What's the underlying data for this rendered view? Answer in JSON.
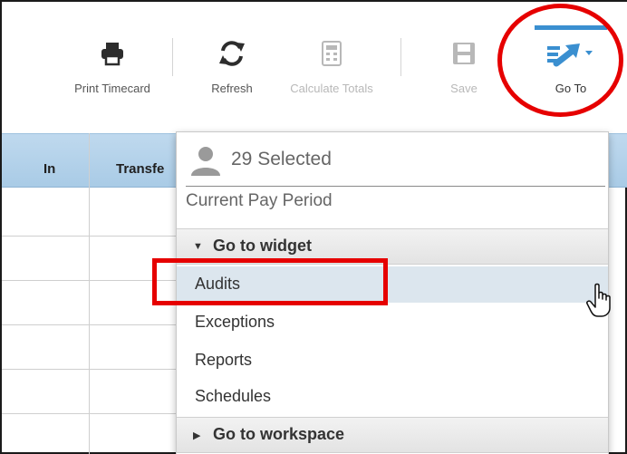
{
  "toolbar": {
    "print_label": "Print Timecard",
    "refresh_label": "Refresh",
    "calculate_label": "Calculate Totals",
    "save_label": "Save",
    "goto_label": "Go To"
  },
  "grid": {
    "columns": [
      "In",
      "Transfe"
    ]
  },
  "menu": {
    "selected_text": "29 Selected",
    "period": "Current Pay Period",
    "widget_section": "Go to widget",
    "widget_items": [
      "Audits",
      "Exceptions",
      "Reports",
      "Schedules"
    ],
    "workspace_section": "Go to workspace",
    "hovered_item": "Audits"
  },
  "icons": {
    "print": "printer-icon",
    "refresh": "refresh-icon",
    "calculate": "calculator-icon",
    "save": "floppy-disk-icon",
    "goto": "goto-arrow-icon",
    "selection": "user-silhouette-icon",
    "cursor": "hand-pointer-icon"
  },
  "colors": {
    "accent": "#3a8fd0",
    "annotation_red": "#e60000",
    "grid_header": "#b3d1ea",
    "hover_row": "#dce6ee"
  }
}
